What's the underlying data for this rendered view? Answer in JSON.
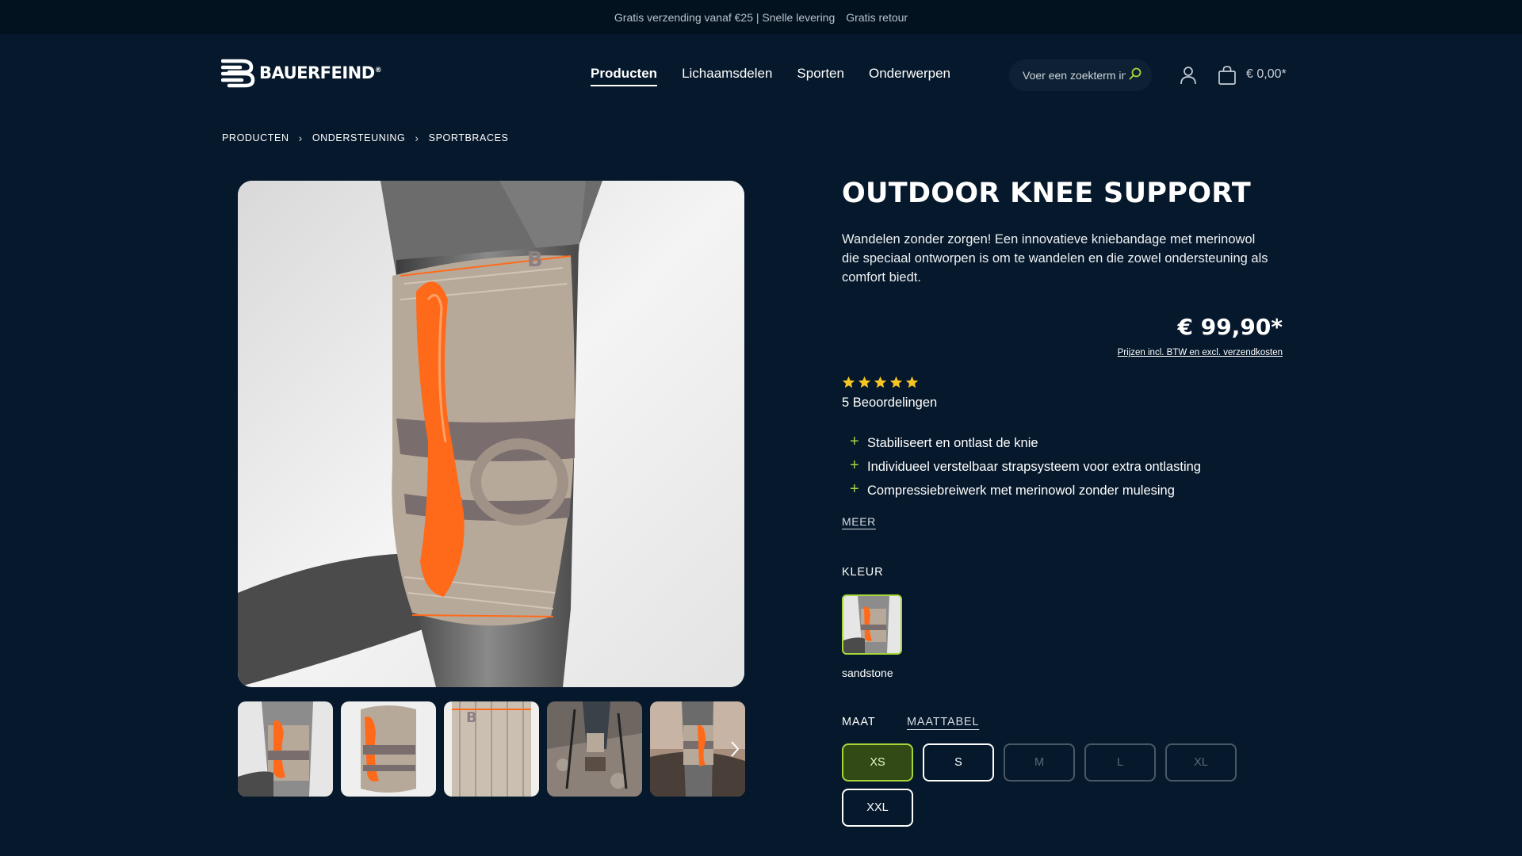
{
  "topbar": {
    "shipping": "Gratis verzending vanaf €25 | Snelle levering",
    "returns": "Gratis retour"
  },
  "header": {
    "brand": "BAUERFEIND",
    "brand_mark": "®",
    "nav": [
      {
        "label": "Producten",
        "active": true
      },
      {
        "label": "Lichaamsdelen",
        "active": false
      },
      {
        "label": "Sporten",
        "active": false
      },
      {
        "label": "Onderwerpen",
        "active": false
      }
    ],
    "search_placeholder": "Voer een zoekterm in",
    "cart_total": "€ 0,00*",
    "icons": [
      "search-icon",
      "user-icon",
      "shopping-bag-icon"
    ]
  },
  "breadcrumb": [
    "PRODUCTEN",
    "ONDERSTEUNING",
    "SPORTBRACES"
  ],
  "product": {
    "title": "OUTDOOR KNEE SUPPORT",
    "description": "Wandelen zonder zorgen! Een innovatieve kniebandage met merinowol die speciaal ontworpen is om te wandelen en die zowel ondersteuning als comfort biedt.",
    "price": "€ 99,90*",
    "price_note": "Prijzen incl. BTW en excl. verzendkosten",
    "rating": 5,
    "reviews": "5 Beoordelingen",
    "usps": [
      "Stabiliseert en ontlast de knie",
      "Individueel verstelbaar strapsysteem voor extra ontlasting",
      "Compressiebreiwerk met merinowol zonder mulesing"
    ],
    "more": "MEER",
    "color_label": "KLEUR",
    "color_name": "sandstone",
    "size_label": "MAAT",
    "size_chart": "MAATTABEL",
    "sizes": [
      {
        "label": "XS",
        "state": "selected"
      },
      {
        "label": "S",
        "state": "available"
      },
      {
        "label": "M",
        "state": "disabled"
      },
      {
        "label": "L",
        "state": "disabled"
      },
      {
        "label": "XL",
        "state": "disabled"
      },
      {
        "label": "XXL",
        "state": "available"
      }
    ]
  },
  "colors": {
    "background": "#06182b",
    "topbar": "#03121f",
    "accent_green": "#a7d63a",
    "star": "#f3c623",
    "brace_orange": "#ff6a1a"
  }
}
